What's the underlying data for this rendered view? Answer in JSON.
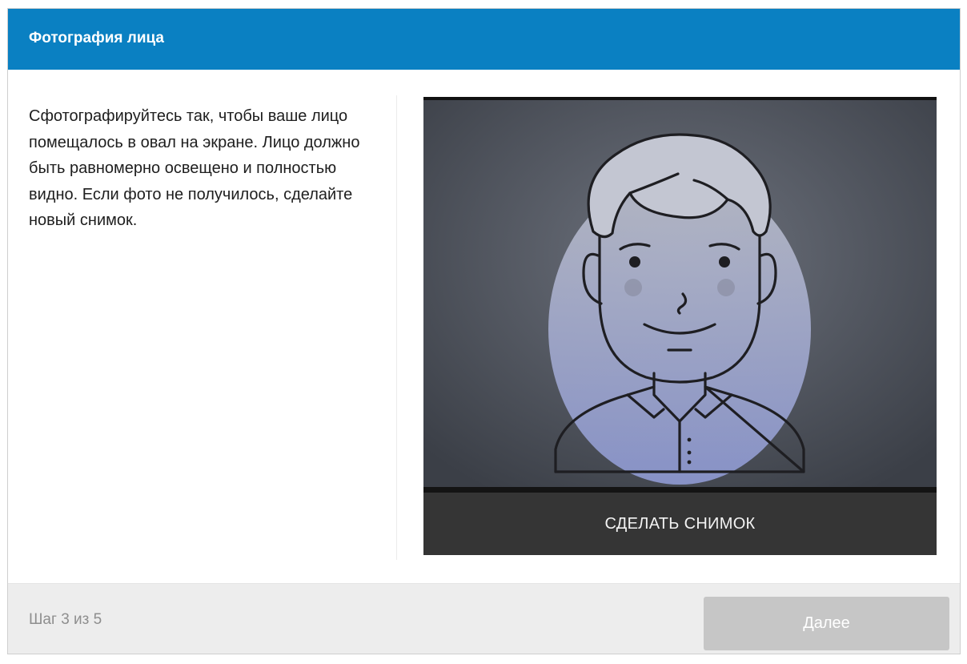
{
  "header": {
    "title": "Фотография лица"
  },
  "instructions": {
    "text": "Сфотографируйтесь так, чтобы ваше лицо помещалось в овал на экране. Лицо должно быть равномерно освещено и полностью видно. Если фото не получилось, сделайте новый снимок."
  },
  "camera": {
    "capture_label": "СДЕЛАТЬ СНИМОК"
  },
  "footer": {
    "step_text": "Шаг 3 из 5",
    "next_label": "Далее",
    "next_enabled": false
  },
  "colors": {
    "header_bg": "#0a80c2",
    "camera_bg": "#2a2a2a",
    "oval_fill": "#9aa6d6",
    "button_disabled": "#c6c6c6"
  }
}
